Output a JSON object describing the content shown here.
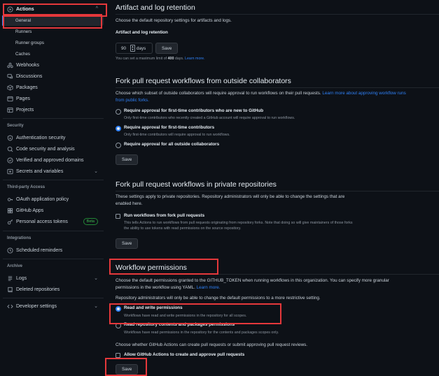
{
  "sidebar": {
    "actions": "Actions",
    "general": "General",
    "runners": "Runners",
    "runner_groups": "Runner groups",
    "caches": "Caches",
    "webhooks": "Webhooks",
    "discussions": "Discussions",
    "packages": "Packages",
    "pages": "Pages",
    "projects": "Projects",
    "security_heading": "Security",
    "authentication_security": "Authentication security",
    "code_security": "Code security and analysis",
    "verified_domains": "Verified and approved domains",
    "secrets_variables": "Secrets and variables",
    "third_party_heading": "Third-party Access",
    "oauth_policy": "OAuth application policy",
    "github_apps": "GitHub Apps",
    "personal_tokens": "Personal access tokens",
    "beta": "Beta",
    "integrations_heading": "Integrations",
    "scheduled_reminders": "Scheduled reminders",
    "archive_heading": "Archive",
    "logs": "Logs",
    "deleted_repositories": "Deleted repositories",
    "developer_settings": "Developer settings"
  },
  "artifact": {
    "title": "Artifact and log retention",
    "desc": "Choose the default repository settings for artifacts and logs.",
    "label": "Artifact and log retention",
    "value": "90",
    "unit": "days",
    "save": "Save",
    "note_prefix": "You can set a maximum limit of ",
    "note_max": "400",
    "note_suffix": " days. ",
    "learn_more": "Learn more."
  },
  "fork_outside": {
    "title": "Fork pull request workflows from outside collaborators",
    "desc": "Choose which subset of outside collaborators will require approval to run workflows on their pull requests.",
    "link_line1": "Learn more about approving workflow runs",
    "link_line2": "from public forks.",
    "opt1_title": "Require approval for first-time contributors who are new to GitHub",
    "opt1_desc": "Only first-time contributors who recently created a GitHub account will require approval to run workflows.",
    "opt2_title": "Require approval for first-time contributors",
    "opt2_desc": "Only first-time contributors will require approval to run workflows.",
    "opt3_title": "Require approval for all outside collaborators",
    "save": "Save"
  },
  "fork_private": {
    "title": "Fork pull request workflows in private repositories",
    "desc_line1": "These settings apply to private repositories. Repository administrators will only be able to change the settings that are",
    "desc_line2": "enabled here.",
    "opt_title": "Run workflows from fork pull requests",
    "opt_desc_line1": "This tells Actions to run workflows from pull requests originating from repository forks. Note that doing so will give maintainers of those forks",
    "opt_desc_line2": "the ability to use tokens with read permissions on the source repository.",
    "save": "Save"
  },
  "workflow_permissions": {
    "title": "Workflow permissions",
    "desc_line1": "Choose the default permissions granted to the GITHUB_TOKEN when running workflows in this organization. You can specify more granular",
    "desc_line2": "permissions in the workflow using YAML.",
    "learn_more": "Learn more.",
    "restrict_note": "Repository administrators will only be able to change the default permissions to a more restrictive setting.",
    "opt1_title": "Read and write permissions",
    "opt1_desc": "Workflows have read and write permissions in the repository for all scopes.",
    "opt2_title": "Read repository contents and packages permissions",
    "opt2_desc": "Workflows have read permissions in the repository for the contents and packages scopes only.",
    "pr_question": "Choose whether GitHub Actions can create pull requests or submit approving pull request reviews.",
    "allow_label": "Allow GitHub Actions to create and approve pull requests",
    "save": "Save"
  },
  "colors": {
    "background": "#0d1117",
    "accent": "#2f81f7",
    "annotation": "#e5383b",
    "beta": "#3fb950"
  }
}
